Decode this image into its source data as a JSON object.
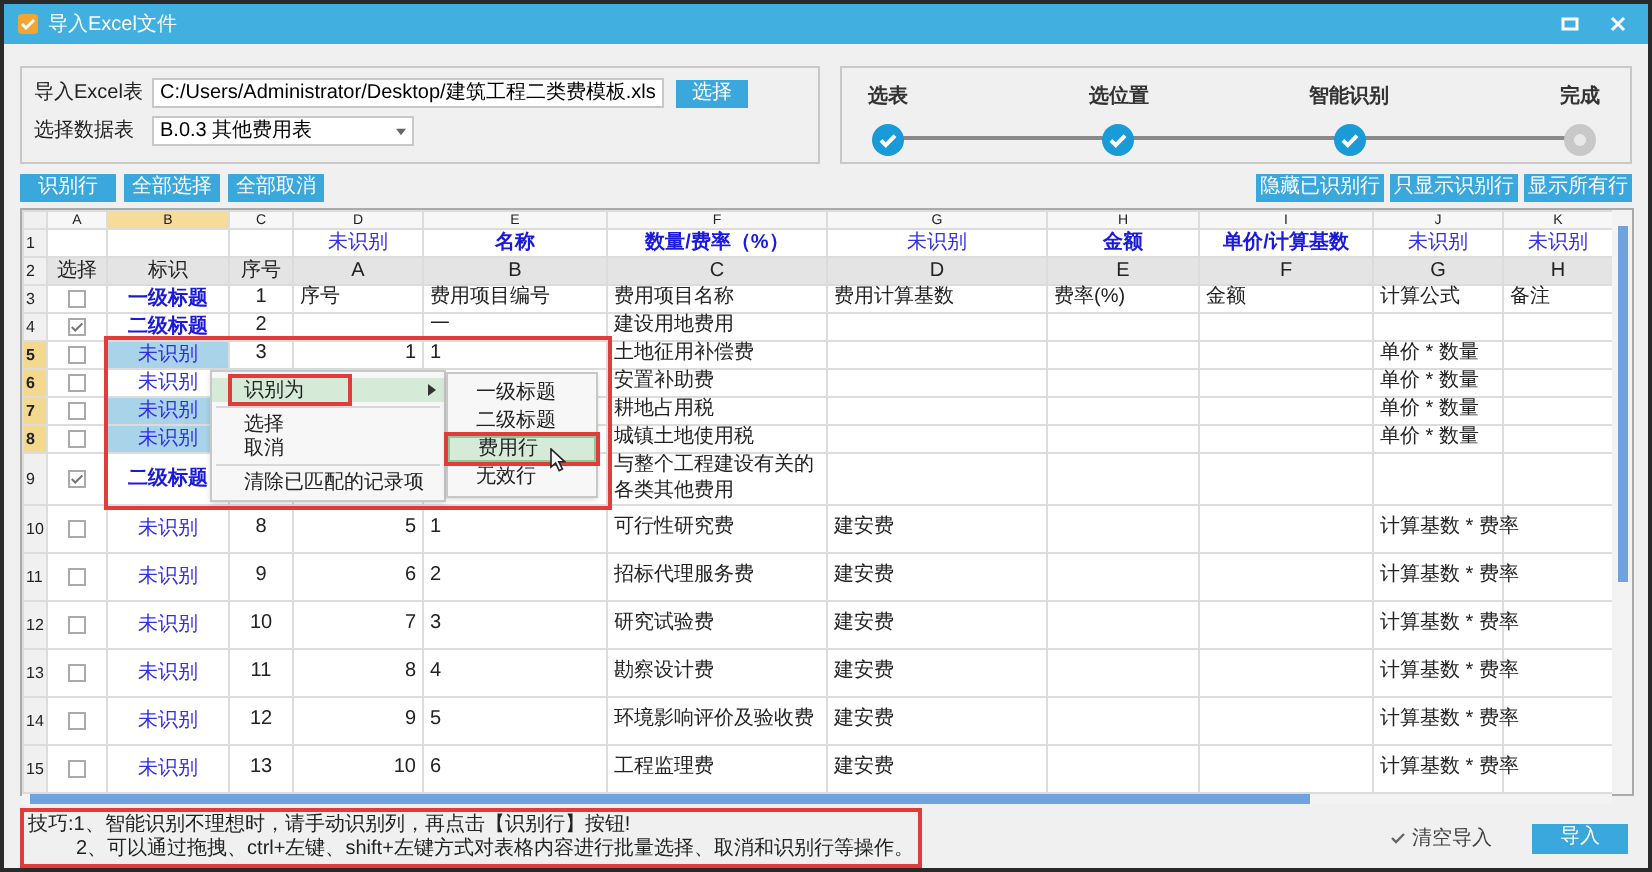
{
  "window": {
    "title": "导入Excel文件"
  },
  "source": {
    "file_label": "导入Excel表",
    "file_path": "C:/Users/Administrator/Desktop/建筑工程二类费模板.xls",
    "browse_button": "选择",
    "sheet_label": "选择数据表",
    "sheet_value": "B.0.3 其他费用表"
  },
  "steps": [
    {
      "label": "选表",
      "done": true
    },
    {
      "label": "选位置",
      "done": true
    },
    {
      "label": "智能识别",
      "done": true
    },
    {
      "label": "完成",
      "done": false
    }
  ],
  "left_buttons": [
    "识别行",
    "全部选择",
    "全部取消"
  ],
  "right_buttons": [
    "隐藏已识别行",
    "只显示识别行",
    "显示所有行"
  ],
  "table": {
    "role_row_number": "1",
    "header_row_number": "2",
    "columns": [
      {
        "letter": "A",
        "header": "选择",
        "selected": false
      },
      {
        "letter": "B",
        "header": "标识",
        "selected": true
      },
      {
        "letter": "C",
        "header": "序号",
        "selected": false
      },
      {
        "letter": "D",
        "header": "A",
        "selected": false,
        "role": {
          "text": "未识别",
          "recognized": false
        }
      },
      {
        "letter": "E",
        "header": "B",
        "selected": false,
        "role": {
          "text": "名称",
          "recognized": true
        }
      },
      {
        "letter": "F",
        "header": "C",
        "selected": false,
        "role": {
          "text": "数量/费率（%）",
          "recognized": true
        }
      },
      {
        "letter": "G",
        "header": "D",
        "selected": false,
        "role": {
          "text": "未识别",
          "recognized": false
        }
      },
      {
        "letter": "H",
        "header": "E",
        "selected": false,
        "role": {
          "text": "金额",
          "recognized": true
        }
      },
      {
        "letter": "I",
        "header": "F",
        "selected": false,
        "role": {
          "text": "单价/计算基数",
          "recognized": true
        }
      },
      {
        "letter": "J",
        "header": "G",
        "selected": false,
        "role": {
          "text": "未识别",
          "recognized": false
        }
      },
      {
        "letter": "K",
        "header": "H",
        "selected": false,
        "role": {
          "text": "未识别",
          "recognized": false
        }
      }
    ],
    "rows": [
      {
        "number": "3",
        "selected": false,
        "cells": [
          {
            "kind": "checkbox",
            "checked": false
          },
          {
            "kind": "mark",
            "text": "一级标题",
            "bold": true,
            "selected": false
          },
          "1",
          "序号",
          "费用项目编号",
          "费用项目名称",
          "费用计算基数",
          "费率(%)",
          "金额",
          "计算公式",
          "备注"
        ]
      },
      {
        "number": "4",
        "selected": false,
        "cells": [
          {
            "kind": "checkbox",
            "checked": true
          },
          {
            "kind": "mark",
            "text": "二级标题",
            "bold": true,
            "selected": false
          },
          "2",
          null,
          "一",
          "建设用地费用",
          null,
          null,
          null,
          null,
          null
        ]
      },
      {
        "number": "5",
        "selected": true,
        "cells": [
          {
            "kind": "checkbox",
            "checked": false
          },
          {
            "kind": "mark",
            "text": "未识别",
            "bold": false,
            "selected": true
          },
          "3",
          {
            "text": "1",
            "numeric": true
          },
          "1",
          "土地征用补偿费",
          null,
          null,
          null,
          "单价 * 数量",
          null
        ]
      },
      {
        "number": "6",
        "selected": true,
        "cells": [
          {
            "kind": "checkbox",
            "checked": false
          },
          {
            "kind": "mark",
            "text": "未识别",
            "bold": false,
            "selected": false
          },
          null,
          null,
          null,
          "安置补助费",
          null,
          null,
          null,
          "单价 * 数量",
          null
        ]
      },
      {
        "number": "7",
        "selected": true,
        "cells": [
          {
            "kind": "checkbox",
            "checked": false
          },
          {
            "kind": "mark",
            "text": "未识别",
            "bold": false,
            "selected": true
          },
          null,
          null,
          null,
          "耕地占用税",
          null,
          null,
          null,
          "单价 * 数量",
          null
        ]
      },
      {
        "number": "8",
        "selected": true,
        "cells": [
          {
            "kind": "checkbox",
            "checked": false
          },
          {
            "kind": "mark",
            "text": "未识别",
            "bold": false,
            "selected": true
          },
          null,
          null,
          null,
          "城镇土地使用税",
          null,
          null,
          null,
          "单价 * 数量",
          null
        ]
      },
      {
        "number": "9",
        "selected": false,
        "cells": [
          {
            "kind": "checkbox",
            "checked": true
          },
          {
            "kind": "mark",
            "text": "二级标题",
            "bold": true,
            "selected": false
          },
          null,
          null,
          null,
          "与整个工程建设有关的各类其他费用",
          null,
          null,
          null,
          null,
          null
        ]
      },
      {
        "number": "10",
        "selected": false,
        "cells": [
          {
            "kind": "checkbox",
            "checked": false
          },
          {
            "kind": "mark",
            "text": "未识别",
            "bold": false,
            "selected": false
          },
          "8",
          {
            "text": "5",
            "numeric": true
          },
          "1",
          "可行性研究费",
          "建安费",
          null,
          null,
          "计算基数 * 费率",
          null
        ]
      },
      {
        "number": "11",
        "selected": false,
        "cells": [
          {
            "kind": "checkbox",
            "checked": false
          },
          {
            "kind": "mark",
            "text": "未识别",
            "bold": false,
            "selected": false
          },
          "9",
          {
            "text": "6",
            "numeric": true
          },
          "2",
          "招标代理服务费",
          "建安费",
          null,
          null,
          "计算基数 * 费率",
          null
        ]
      },
      {
        "number": "12",
        "selected": false,
        "cells": [
          {
            "kind": "checkbox",
            "checked": false
          },
          {
            "kind": "mark",
            "text": "未识别",
            "bold": false,
            "selected": false
          },
          "10",
          {
            "text": "7",
            "numeric": true
          },
          "3",
          "研究试验费",
          "建安费",
          null,
          null,
          "计算基数 * 费率",
          null
        ]
      },
      {
        "number": "13",
        "selected": false,
        "cells": [
          {
            "kind": "checkbox",
            "checked": false
          },
          {
            "kind": "mark",
            "text": "未识别",
            "bold": false,
            "selected": false
          },
          "11",
          {
            "text": "8",
            "numeric": true
          },
          "4",
          "勘察设计费",
          "建安费",
          null,
          null,
          "计算基数 * 费率",
          null
        ]
      },
      {
        "number": "14",
        "selected": false,
        "cells": [
          {
            "kind": "checkbox",
            "checked": false
          },
          {
            "kind": "mark",
            "text": "未识别",
            "bold": false,
            "selected": false
          },
          "12",
          {
            "text": "9",
            "numeric": true
          },
          "5",
          "环境影响评价及验收费",
          "建安费",
          null,
          null,
          "计算基数 * 费率",
          null
        ]
      },
      {
        "number": "15",
        "selected": false,
        "cells": [
          {
            "kind": "checkbox",
            "checked": false
          },
          {
            "kind": "mark",
            "text": "未识别",
            "bold": false,
            "selected": false
          },
          "13",
          {
            "text": "10",
            "numeric": true
          },
          "6",
          "工程监理费",
          "建安费",
          null,
          null,
          "计算基数 * 费率",
          null
        ]
      }
    ]
  },
  "context_menu": {
    "items": [
      {
        "kind": "submenu",
        "label": "识别为",
        "highlighted": true
      },
      {
        "kind": "separator"
      },
      {
        "kind": "item",
        "label": "选择",
        "highlighted": false
      },
      {
        "kind": "item",
        "label": "取消",
        "highlighted": false
      },
      {
        "kind": "separator"
      },
      {
        "kind": "item",
        "label": "清除已匹配的记录项",
        "highlighted": false
      }
    ],
    "submenu": [
      {
        "label": "一级标题",
        "selected": false
      },
      {
        "label": "二级标题",
        "selected": false
      },
      {
        "label": "费用行",
        "selected": true
      },
      {
        "label": "无效行",
        "selected": false
      }
    ]
  },
  "tips": [
    "技巧:1、智能识别不理想时，请手动识别列，再点击【识别行】按钮!",
    "2、可以通过拖拽、ctrl+左键、shift+左键方式对表格内容进行批量选择、取消和识别行等操作。"
  ],
  "footer": {
    "clear_import": {
      "label": "清空导入",
      "checked": true
    },
    "import_button": "导入"
  }
}
